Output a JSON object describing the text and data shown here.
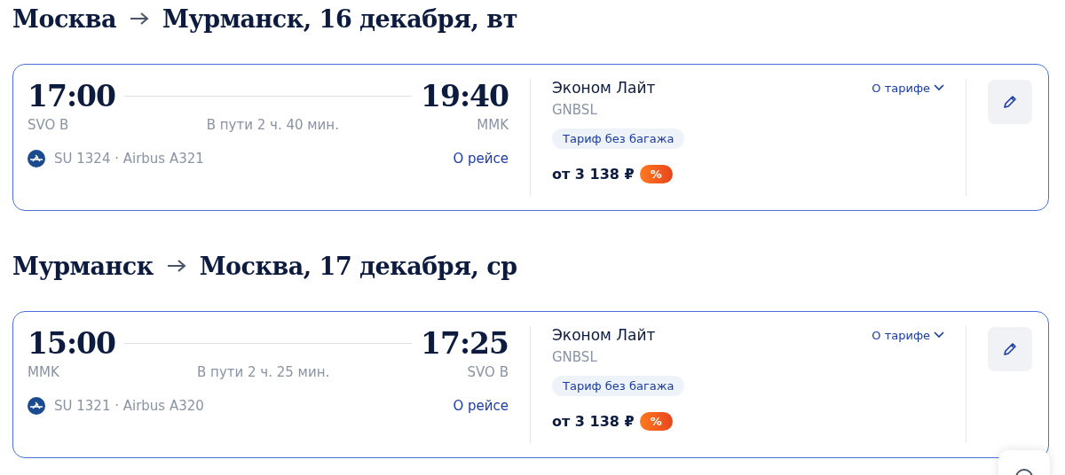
{
  "segments": [
    {
      "from": "Москва",
      "to": "Мурманск, 16 декабря, вт",
      "dep_time": "17:00",
      "arr_time": "19:40",
      "dep_airport": "SVO B",
      "arr_airport": "MMK",
      "duration": "В пути 2 ч. 40 мин.",
      "flight": "SU 1324 · Airbus A321",
      "flight_link": "О рейсе",
      "fare_name": "Эконом Лайт",
      "fare_code": "GNBSL",
      "fare_link": "О тарифе",
      "fare_tag": "Тариф без багажа",
      "price": "от 3 138 ₽",
      "discount": "%"
    },
    {
      "from": "Мурманск",
      "to": "Москва, 17 декабря, ср",
      "dep_time": "15:00",
      "arr_time": "17:25",
      "dep_airport": "MMK",
      "arr_airport": "SVO B",
      "duration": "В пути 2 ч. 25 мин.",
      "flight": "SU 1321 · Airbus A320",
      "flight_link": "О рейсе",
      "fare_name": "Эконом Лайт",
      "fare_code": "GNBSL",
      "fare_link": "О тарифе",
      "fare_tag": "Тариф без багажа",
      "price": "от 3 138 ₽",
      "discount": "%"
    }
  ]
}
